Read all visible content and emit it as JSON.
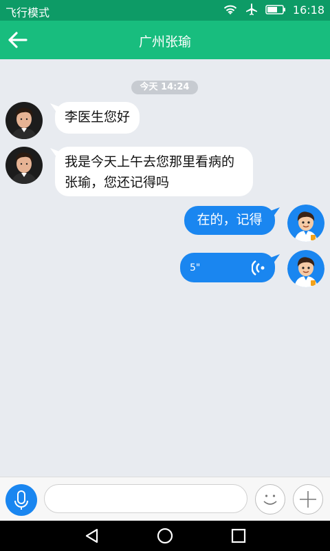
{
  "status_bar": {
    "carrier": "飞行模式",
    "time": "16:18"
  },
  "header": {
    "title": "广州张瑜"
  },
  "chat": {
    "timestamp": "今天 14:24",
    "messages": [
      {
        "from": "patient",
        "text": "李医生您好"
      },
      {
        "from": "patient",
        "text": "我是今天上午去您那里看病的张瑜，您还记得吗"
      },
      {
        "from": "doctor",
        "text": "在的，记得"
      },
      {
        "from": "doctor",
        "type": "voice",
        "duration": "5\""
      }
    ]
  },
  "input": {
    "placeholder": ""
  },
  "colors": {
    "status_bar": "#0d9b66",
    "header": "#18bd7e",
    "outgoing": "#1a86f0",
    "background": "#e8ebf0"
  },
  "icons": [
    "back-arrow-icon",
    "wifi-icon",
    "airplane-icon",
    "battery-icon",
    "mic-icon",
    "emoji-icon",
    "plus-icon",
    "nav-back-icon",
    "nav-home-icon",
    "nav-recents-icon",
    "voice-wave-icon"
  ]
}
